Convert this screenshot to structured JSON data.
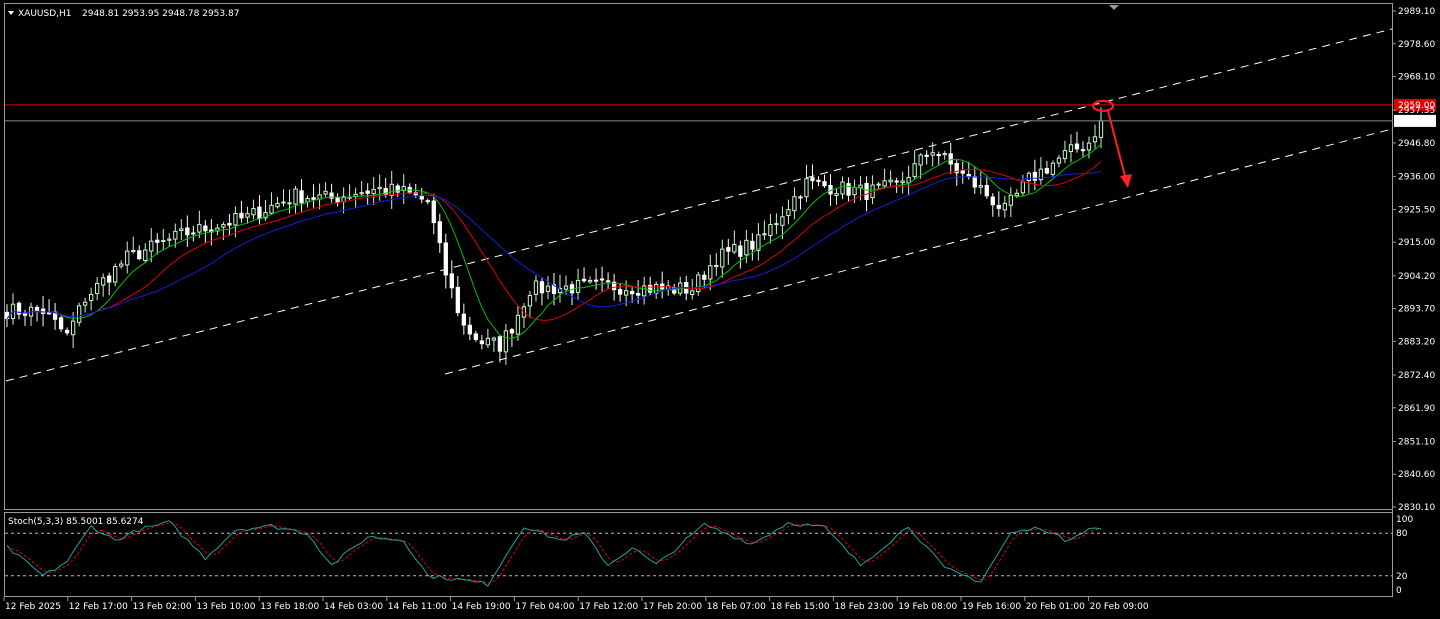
{
  "header": {
    "symbol": "XAUUSD,H1",
    "ohlc": "2948.81 2953.95 2948.78 2953.87",
    "dropdown_icon": "triangle-down-icon"
  },
  "price_axis": {
    "ticks": [
      "2989.10",
      "2978.60",
      "2968.10",
      "2957.35",
      "2946.80",
      "2936.00",
      "2925.50",
      "2915.00",
      "2904.20",
      "2893.70",
      "2883.20",
      "2872.40",
      "2861.90",
      "2851.10",
      "2840.60",
      "2830.10"
    ],
    "red_level_label": "2959.00",
    "current_price_label": "2953.87",
    "red_level": 2959.0,
    "current_price": 2953.87
  },
  "stoch": {
    "title": "Stoch(5,3,3) 85.5001 85.6274",
    "ticks": [
      "100",
      "80",
      "20",
      "0"
    ],
    "levels": [
      80,
      20
    ]
  },
  "time_axis": {
    "labels": [
      "12 Feb 2025",
      "12 Feb 17:00",
      "13 Feb 02:00",
      "13 Feb 10:00",
      "13 Feb 18:00",
      "14 Feb 03:00",
      "14 Feb 11:00",
      "14 Feb 19:00",
      "17 Feb 04:00",
      "17 Feb 12:00",
      "17 Feb 20:00",
      "18 Feb 07:00",
      "18 Feb 15:00",
      "18 Feb 23:00",
      "19 Feb 08:00",
      "19 Feb 16:00",
      "20 Feb 01:00",
      "20 Feb 09:00"
    ]
  },
  "colors": {
    "background": "#000000",
    "bull": "#c6f7c6",
    "bear": "#ffffff",
    "ma_fast": "#00c000",
    "ma_mid": "#e00000",
    "ma_slow": "#1020e0",
    "red_level": "#e00000",
    "stoch_main": "#20a0a0",
    "stoch_signal": "#e00000",
    "channel": "#ffffff"
  },
  "chart_data": {
    "type": "candlestick",
    "symbol": "XAUUSD",
    "timeframe": "H1",
    "ylim": [
      2830.1,
      2989.1
    ],
    "close_path": [
      [
        0,
        2893
      ],
      [
        6,
        2893
      ],
      [
        10,
        2885
      ],
      [
        13,
        2897
      ],
      [
        20,
        2910
      ],
      [
        30,
        2918
      ],
      [
        40,
        2923
      ],
      [
        48,
        2930
      ],
      [
        54,
        2929
      ],
      [
        58,
        2931
      ],
      [
        62,
        2932
      ],
      [
        66,
        2931
      ],
      [
        70,
        2928
      ],
      [
        73,
        2905
      ],
      [
        76,
        2888
      ],
      [
        79,
        2883
      ],
      [
        82,
        2882
      ],
      [
        84,
        2888
      ],
      [
        87,
        2900
      ],
      [
        100,
        2901
      ],
      [
        110,
        2900
      ],
      [
        114,
        2900
      ],
      [
        118,
        2910
      ],
      [
        125,
        2915
      ],
      [
        133,
        2934
      ],
      [
        143,
        2931
      ],
      [
        148,
        2933
      ],
      [
        154,
        2945
      ],
      [
        158,
        2938
      ],
      [
        162,
        2932
      ],
      [
        166,
        2925
      ],
      [
        170,
        2935
      ],
      [
        176,
        2943
      ],
      [
        180,
        2947
      ],
      [
        182,
        2953.87
      ]
    ],
    "stoch_path": [
      [
        0,
        60
      ],
      [
        6,
        20
      ],
      [
        10,
        40
      ],
      [
        14,
        90
      ],
      [
        18,
        70
      ],
      [
        22,
        85
      ],
      [
        27,
        95
      ],
      [
        33,
        45
      ],
      [
        38,
        85
      ],
      [
        44,
        90
      ],
      [
        50,
        80
      ],
      [
        54,
        35
      ],
      [
        60,
        75
      ],
      [
        66,
        70
      ],
      [
        70,
        20
      ],
      [
        75,
        15
      ],
      [
        80,
        8
      ],
      [
        86,
        90
      ],
      [
        92,
        70
      ],
      [
        96,
        80
      ],
      [
        100,
        35
      ],
      [
        104,
        60
      ],
      [
        108,
        35
      ],
      [
        116,
        92
      ],
      [
        124,
        65
      ],
      [
        130,
        95
      ],
      [
        136,
        88
      ],
      [
        142,
        35
      ],
      [
        150,
        90
      ],
      [
        156,
        30
      ],
      [
        162,
        12
      ],
      [
        167,
        80
      ],
      [
        172,
        88
      ],
      [
        176,
        70
      ],
      [
        180,
        87
      ],
      [
        182,
        85.5
      ]
    ]
  }
}
